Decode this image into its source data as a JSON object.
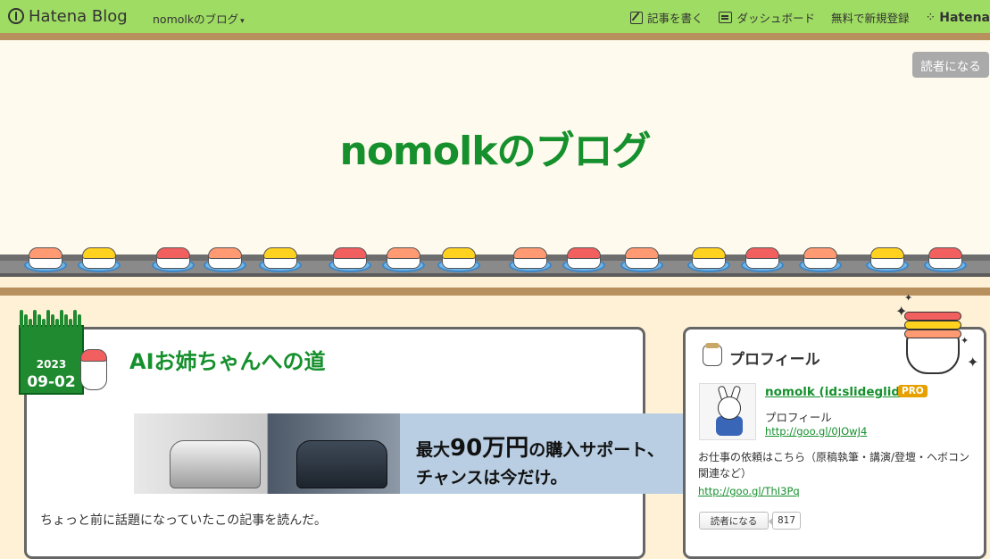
{
  "topbar": {
    "logo_text": "Hatena Blog",
    "blog_menu": "nomolkのブログ",
    "write_label": "記事を書く",
    "dashboard_label": "ダッシュボード",
    "signup_label": "無料で新規登録",
    "hatena_label": "Hatena"
  },
  "header": {
    "subscribe_label": "読者になる",
    "blog_title": "nomolkのブログ"
  },
  "entry": {
    "date_year": "2023",
    "date_md": "09-02",
    "title": "AIお姉ちゃんへの道",
    "ad_line1_prefix": "最大",
    "ad_line1_big": "90万円",
    "ad_line1_suffix": "の購入サポート、",
    "ad_line2": "チャンスは今だけ。",
    "first_line": "ちょっと前に話題になっていたこの記事を読んだ。"
  },
  "sidebar": {
    "title": "プロフィール",
    "profile_name": "nomolk (id:slideglide)",
    "pro_badge": "PRO",
    "profile_label": "プロフィール",
    "profile_link1": "http://goo.gl/0JOwJ4",
    "profile_desc": "お仕事の依頼はこちら（原稿執筆・講演/登壇・ヘボコン関連など）",
    "profile_link2": "http://goo.gl/ThI3Pq",
    "reader_label": "読者になる",
    "reader_count": "817"
  },
  "colors": {
    "topbar_bg": "#9fdc63",
    "accent_green": "#15902c",
    "page_bg": "#fff1d6",
    "brown_band": "#b8905d"
  }
}
